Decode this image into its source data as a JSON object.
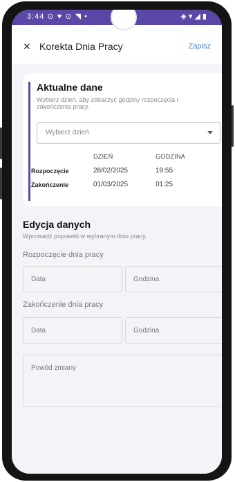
{
  "status_bar": {
    "left_text": "3:44 ⊙ ♥ ⊙ ◥ •",
    "right_text": "◈ ▾ ◢ ▮"
  },
  "app_bar": {
    "close_icon": "close-icon",
    "title": "Korekta Dnia Pracy",
    "save_label": "Zapisz"
  },
  "current_data": {
    "title": "Aktualne dane",
    "hint": "Wybierz dzień, aby zobaczyć godziny rozpoczęcia i zakończenia pracy.",
    "day_select_placeholder": "Wybierz dzień",
    "col_day": "DZIEŃ",
    "col_time": "GODZINA",
    "rows": [
      {
        "label": "Rozpoczęcie",
        "day": "28/02/2025",
        "time": "19:55"
      },
      {
        "label": "Zakończenie",
        "day": "01/03/2025",
        "time": "01:25"
      }
    ]
  },
  "edit_data": {
    "title": "Edycja danych",
    "hint": "Wprowadź poprawki w wybranym dniu pracy.",
    "start_label": "Rozpoczęcie dnia pracy",
    "end_label": "Zakończenie dnia pracy",
    "date_placeholder": "Data",
    "time_placeholder": "Godzina",
    "reason_placeholder": "Powód zmiany"
  },
  "colors": {
    "accent": "#5a47a8",
    "link": "#4a7fd4",
    "page_background": "#f4f4f8"
  }
}
